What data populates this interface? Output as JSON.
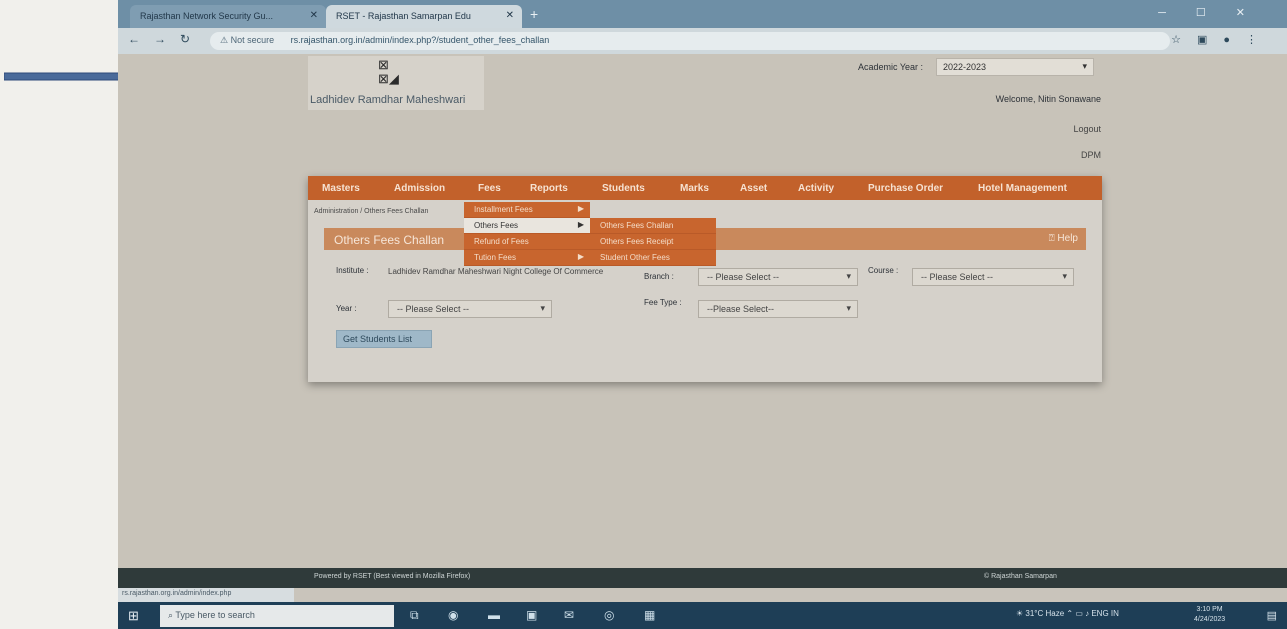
{
  "browser": {
    "tabs": [
      {
        "title": "Rajasthan Network Security Gu..."
      },
      {
        "title": "RSET - Rajasthan Samarpan Edu"
      }
    ],
    "new_tab": "+",
    "security": "Not secure",
    "url": "rs.rajasthan.org.in/admin/index.php?/student_other_fees_challan",
    "status_url": "rs.rajasthan.org.in/admin/index.php"
  },
  "header": {
    "logo_text": "Ladhidev Ramdhar Maheshwari",
    "academic_year_label": "Academic Year :",
    "academic_year_value": "2022-2023",
    "welcome": "Welcome, Nitin Sonawane",
    "logout": "Logout",
    "dpm": "DPM"
  },
  "menu": {
    "items": [
      "Masters",
      "Admission",
      "Fees",
      "Reports",
      "Students",
      "Marks",
      "Asset",
      "Activity",
      "Purchase Order",
      "Hotel Management"
    ]
  },
  "breadcrumb": "Administration / Others Fees Challan",
  "fees_dropdown": {
    "items": [
      "Installment Fees",
      "Others Fees",
      "Refund of Fees",
      "Tution Fees"
    ]
  },
  "others_submenu": {
    "items": [
      "Others Fees Challan",
      "Others Fees Receipt",
      "Student Other Fees"
    ]
  },
  "section": {
    "title": "Others Fees Challan",
    "help": "Help"
  },
  "form": {
    "institute_label": "Institute :",
    "institute_value": "Ladhidev Ramdhar Maheshwari Night College Of Commerce",
    "branch_label": "Branch :",
    "branch_placeholder": "-- Please Select --",
    "course_label": "Course :",
    "course_placeholder": "-- Please Select --",
    "year_label": "Year :",
    "year_placeholder": "-- Please Select --",
    "fee_type_label": "Fee Type :",
    "fee_type_placeholder": "--Please Select--",
    "get_button": "Get Students List"
  },
  "footer": {
    "left": "Powered by RSET (Best viewed in Mozilla Firefox)",
    "right": "© Rajasthan Samarpan"
  },
  "taskbar": {
    "search_placeholder": "Type here to search",
    "weather": "31°C Haze",
    "lang": "ENG IN",
    "time": "3:10 PM",
    "date": "4/24/2023"
  }
}
